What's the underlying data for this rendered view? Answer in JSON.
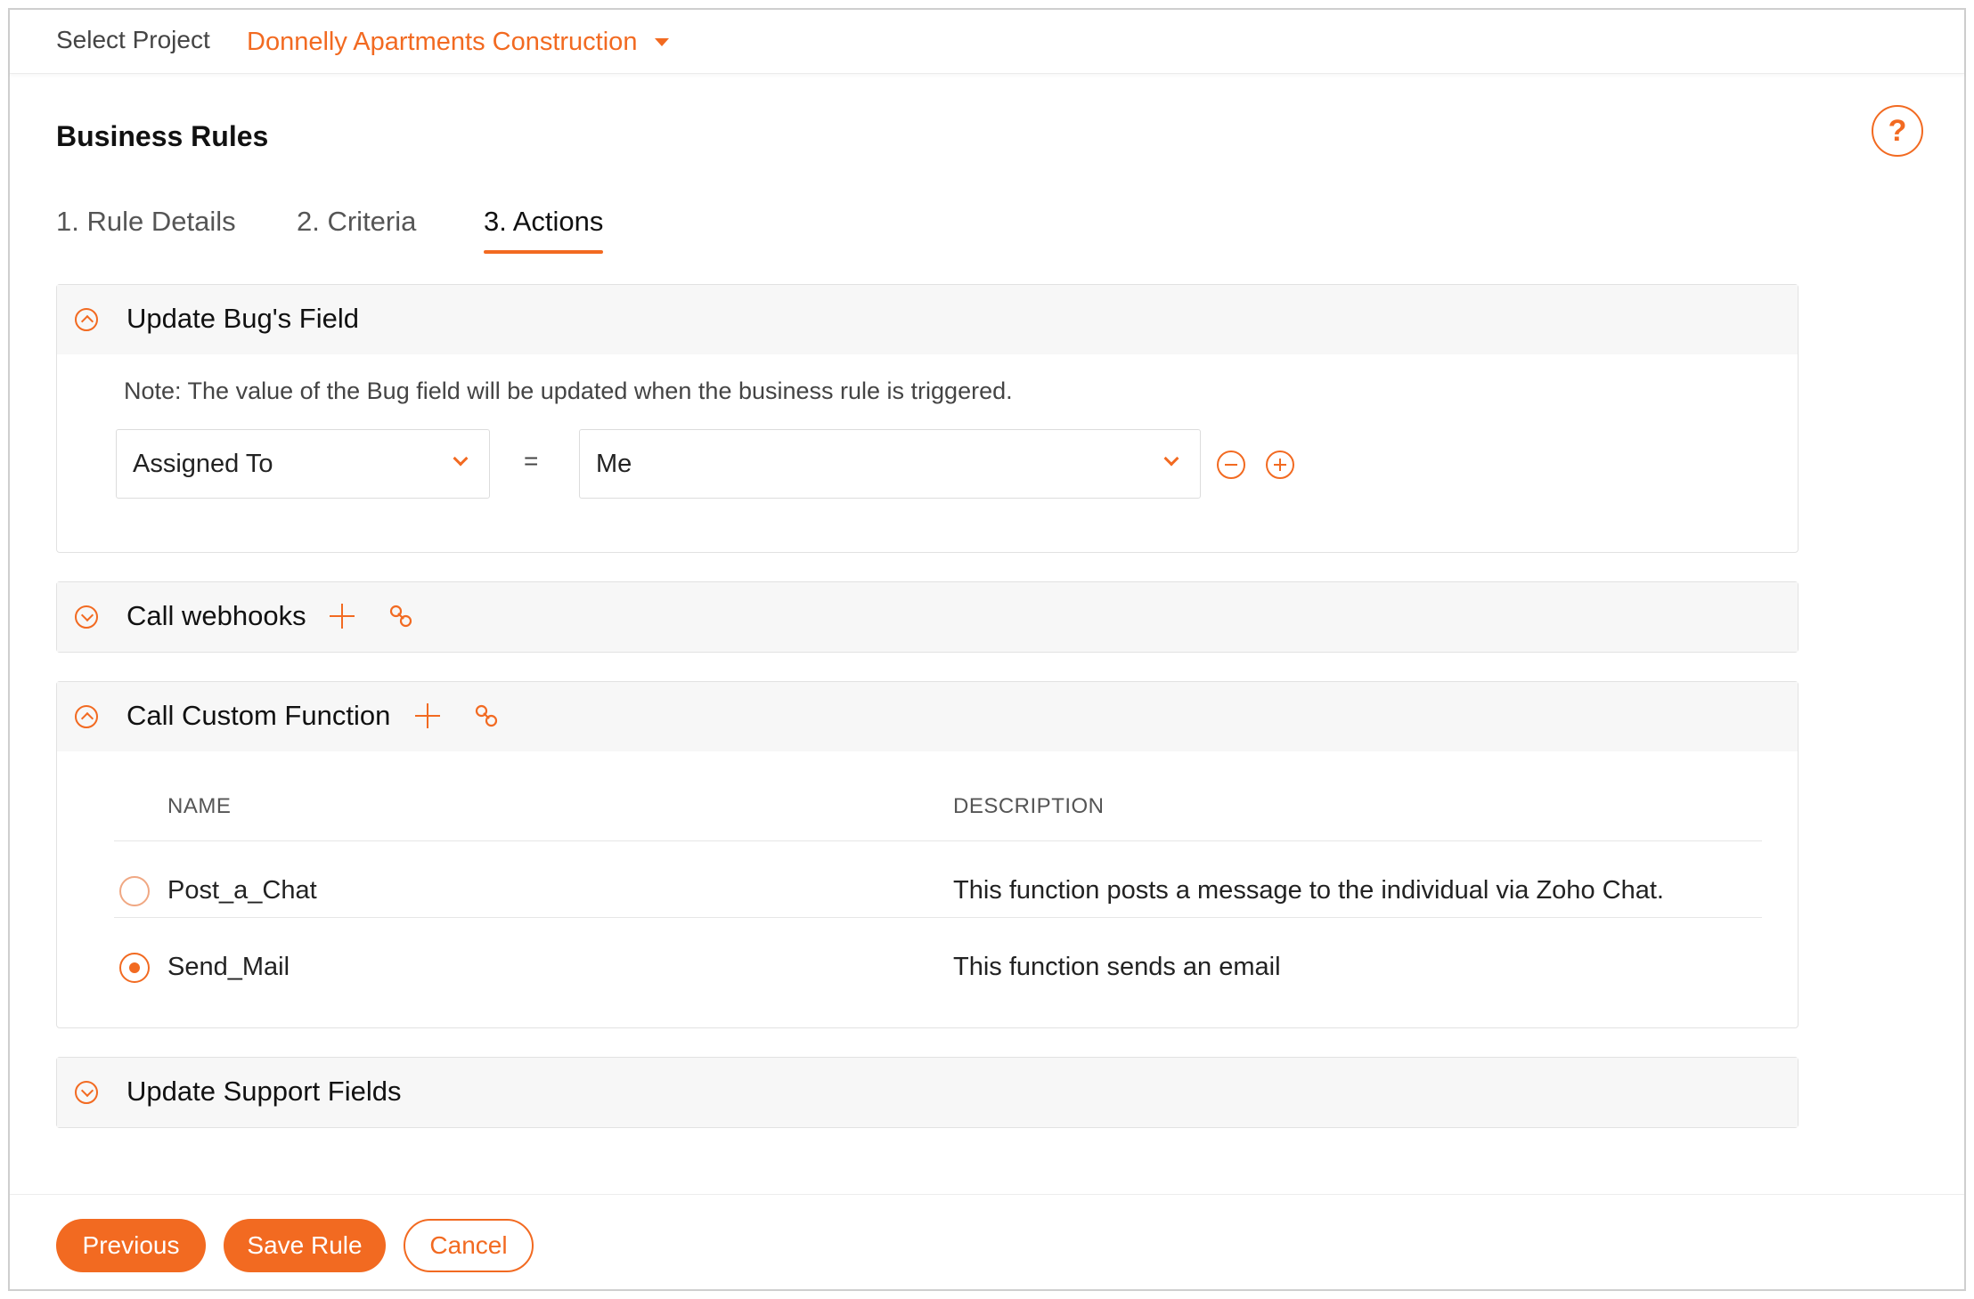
{
  "header": {
    "select_project_label": "Select Project",
    "project_name": "Donnelly Apartments Construction"
  },
  "page": {
    "title": "Business Rules",
    "help_icon": "?"
  },
  "tabs": [
    {
      "label": "1. Rule Details",
      "active": false
    },
    {
      "label": "2. Criteria",
      "active": false
    },
    {
      "label": "3. Actions",
      "active": true
    }
  ],
  "update_bug_field": {
    "title": "Update Bug's Field",
    "note": "Note: The value of the Bug field will be updated when the business rule is triggered.",
    "field_select": "Assigned To",
    "operator": "=",
    "value_select": "Me"
  },
  "call_webhooks": {
    "title": "Call webhooks"
  },
  "call_custom_function": {
    "title": "Call Custom Function",
    "columns": [
      "NAME",
      "DESCRIPTION"
    ],
    "rows": [
      {
        "name": "Post_a_Chat",
        "description": "This function posts a message to the individual via Zoho Chat.",
        "selected": false
      },
      {
        "name": "Send_Mail",
        "description": "This function sends an email",
        "selected": true
      }
    ]
  },
  "update_support_fields": {
    "title": "Update Support Fields"
  },
  "footer": {
    "previous_label": "Previous",
    "save_label": "Save Rule",
    "cancel_label": "Cancel"
  },
  "colors": {
    "accent": "#f26a21"
  }
}
